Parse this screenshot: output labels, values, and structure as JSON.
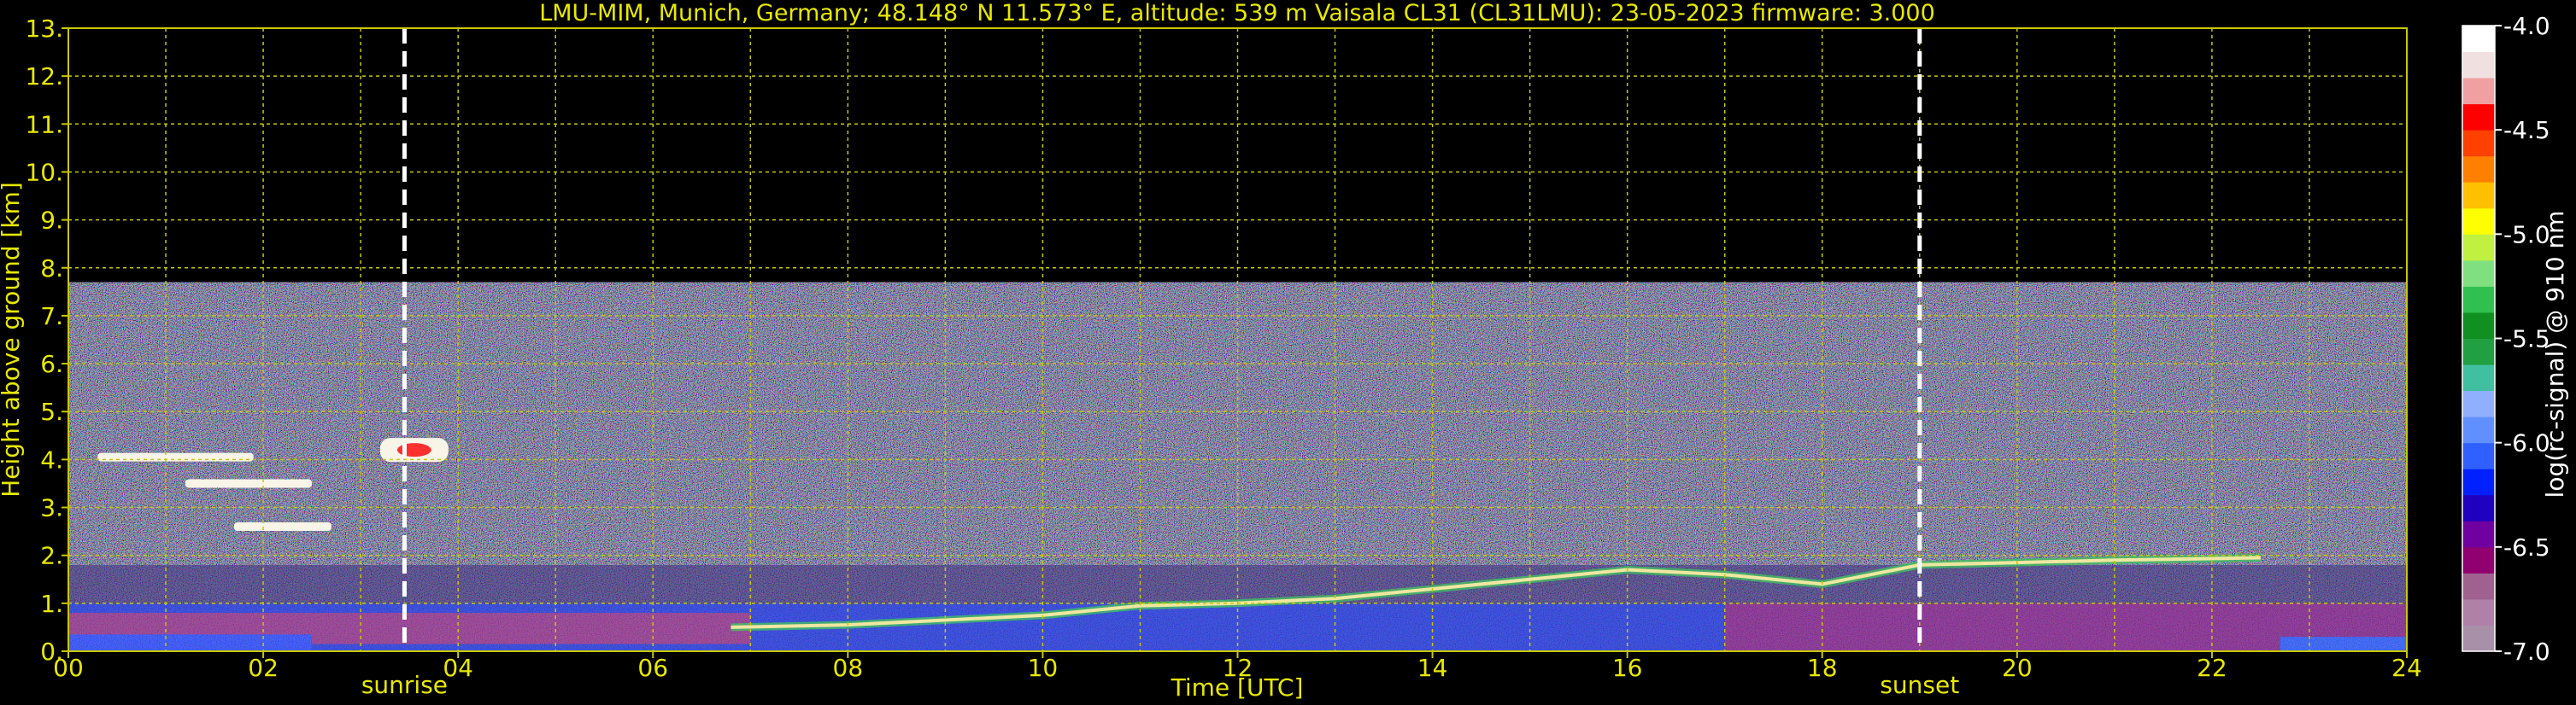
{
  "chart_data": {
    "type": "heatmap",
    "title": "LMU-MIM, Munich, Germany; 48.148° N 11.573° E, altitude: 539 m    Vaisala CL31 (CL31LMU): 23-05-2023    firmware: 3.000",
    "xlabel": "Time [UTC]",
    "ylabel": "Height above ground [km]",
    "xlim": [
      0,
      24
    ],
    "ylim": [
      0,
      13
    ],
    "x_ticks": [
      0,
      2,
      4,
      6,
      8,
      10,
      12,
      14,
      16,
      18,
      20,
      22,
      24
    ],
    "x_tick_labels": [
      "00",
      "02",
      "04",
      "06",
      "08",
      "10",
      "12",
      "14",
      "16",
      "18",
      "20",
      "22",
      "24"
    ],
    "y_ticks": [
      0,
      1,
      2,
      3,
      4,
      5,
      6,
      7,
      8,
      9,
      10,
      11,
      12,
      13
    ],
    "y_tick_labels": [
      "0.",
      "1.",
      "2.",
      "3.",
      "4.",
      "5.",
      "6.",
      "7.",
      "8.",
      "9.",
      "10.",
      "11.",
      "12.",
      "13."
    ],
    "grid": true,
    "data_top_km": 7.7,
    "markers": [
      {
        "label": "sunrise",
        "time": 3.45
      },
      {
        "label": "sunset",
        "time": 19.0
      }
    ],
    "colorbar": {
      "label": "log(rc-signal) @ 910 nm",
      "range": [
        -7.0,
        -4.0
      ],
      "ticks": [
        -7.0,
        -6.5,
        -6.0,
        -5.5,
        -5.0,
        -4.5,
        -4.0
      ],
      "tick_labels": [
        "-7.0",
        "-6.5",
        "-6.0",
        "-5.5",
        "-5.0",
        "-4.5",
        "-4.0"
      ],
      "colors": [
        "#a890a8",
        "#b080a8",
        "#a06090",
        "#900070",
        "#7000a0",
        "#2000c0",
        "#0020ff",
        "#3060ff",
        "#6090ff",
        "#90b0ff",
        "#40c0a0",
        "#20a040",
        "#109020",
        "#30c050",
        "#80e080",
        "#c0f040",
        "#ffff00",
        "#ffc000",
        "#ff8000",
        "#ff4000",
        "#ff0000",
        "#f0a0a0",
        "#f0e0e0",
        "#ffffff"
      ]
    },
    "features": {
      "boundary_layer": [
        {
          "t": 6.8,
          "h": 0.5
        },
        {
          "t": 8,
          "h": 0.55
        },
        {
          "t": 9,
          "h": 0.65
        },
        {
          "t": 10,
          "h": 0.75
        },
        {
          "t": 11,
          "h": 0.95
        },
        {
          "t": 12,
          "h": 1.0
        },
        {
          "t": 13,
          "h": 1.1
        },
        {
          "t": 14,
          "h": 1.3
        },
        {
          "t": 15,
          "h": 1.5
        },
        {
          "t": 16,
          "h": 1.7
        },
        {
          "t": 17,
          "h": 1.6
        },
        {
          "t": 18,
          "h": 1.4
        },
        {
          "t": 19,
          "h": 1.8
        },
        {
          "t": 20,
          "h": 1.85
        },
        {
          "t": 21,
          "h": 1.9
        },
        {
          "t": 22.5,
          "h": 1.95
        }
      ],
      "cloud_layers": [
        {
          "t0": 0.3,
          "t1": 1.9,
          "h": 4.05
        },
        {
          "t0": 1.2,
          "t1": 2.5,
          "h": 3.5
        },
        {
          "t0": 1.7,
          "t1": 2.7,
          "h": 2.6
        },
        {
          "t0": 3.2,
          "t1": 3.9,
          "h": 4.2
        }
      ]
    }
  }
}
